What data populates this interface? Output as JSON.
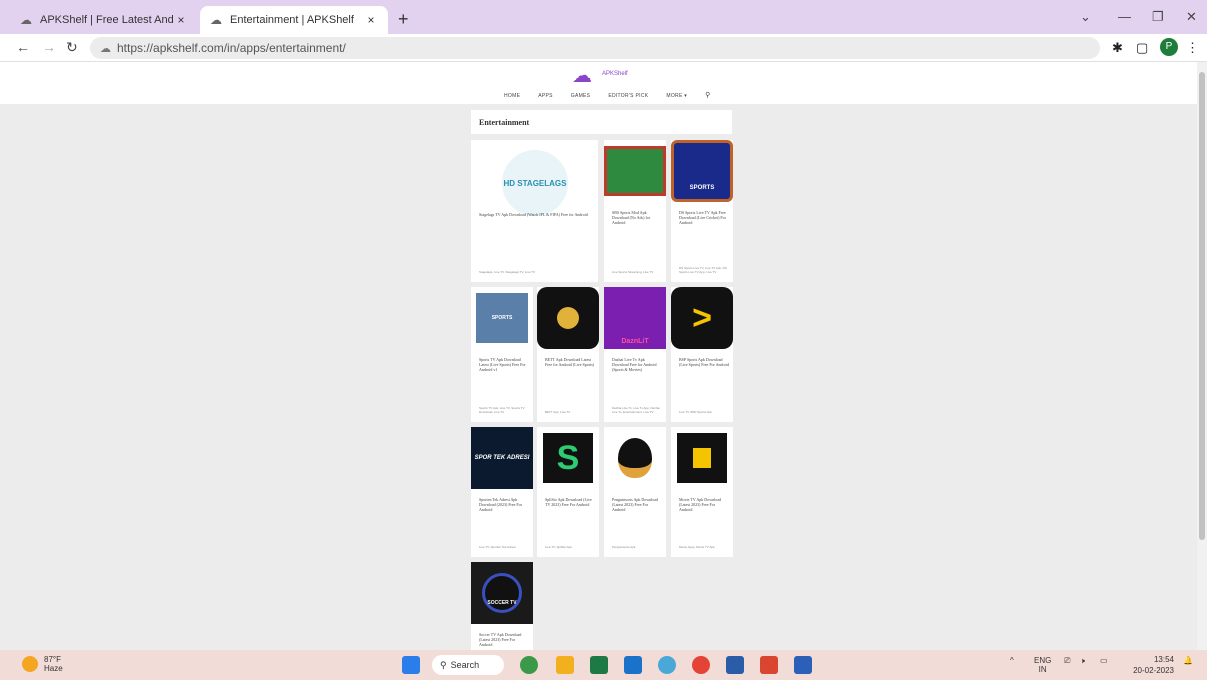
{
  "browser": {
    "tabs": [
      {
        "title": "APKShelf | Free Latest Android A",
        "close": "×"
      },
      {
        "title": "Entertainment | APKShelf",
        "close": "×"
      }
    ],
    "new_tab": "+",
    "url": "https://apkshelf.com/in/apps/entertainment/",
    "profile_initial": "P"
  },
  "site": {
    "logo_text": "APKShelf",
    "menu": [
      "HOME",
      "APPS",
      "GAMES",
      "EDITOR'S PICK",
      "MORE ▾"
    ],
    "section_title": "Entertainment"
  },
  "cards": [
    {
      "title": "Stagelags TV Apk Download (Watch IPL & FIFA) Free for Android",
      "meta": "Stagelags, Live TV, Stagelags TV, Live TV",
      "thumb_label": "HD STAGELAGS",
      "thumb_color": "#e8f4f8"
    },
    {
      "title": "SBS Sports Mod Apk Download (No Ads) for Android",
      "meta": "Live Sports Streaming, Live TV",
      "thumb_label": "",
      "thumb_color": "#2d8a3e"
    },
    {
      "title": "DS Sports Live TV Apk Free Download (Live Cricket) For Android",
      "meta": "DS Sports Live TV, Live TV Apk, DS Sports Live TV App, Live TV",
      "thumb_label": "SPORTS",
      "thumb_color": "#1a2a8a"
    },
    {
      "title": "Sports TV Apk Download Latest (Live Sports) Free For Android v1",
      "meta": "Sports TV Apk, Live TV, Sports TV Download, Live TV",
      "thumb_label": "SPORTS",
      "thumb_color": "#5a7fa8"
    },
    {
      "title": "BETT Apk Download Latest Free for Android (Live Sports)",
      "meta": "BETT Apk, Live TV",
      "thumb_label": "",
      "thumb_color": "#111111"
    },
    {
      "title": "Dazhai Live Tv Apk Download Free for Android (Sports & Movies)",
      "meta": "Dazhai Live Tv, Live Tv App, Dazhai Live Tv, Entertainment, Live TV",
      "thumb_label": "DaznLiT",
      "thumb_color": "#7a1fb0"
    },
    {
      "title": "BSP Sports Apk Download (Live Sports) Free For Android",
      "meta": "Live TV, BSP Sports Apk",
      "thumb_label": "",
      "thumb_color": "#111111"
    },
    {
      "title": "Sporten Tek Adresi Apk Download (2023) Free For Android",
      "meta": "Live TV, Sporten Tek Adresi",
      "thumb_label": "SPOR TEK ADRESI",
      "thumb_color": "#0b1a2e"
    },
    {
      "title": "SpliSto Apk Download (Live TV 2023) Free For Android",
      "meta": "Live TV, SpliSto Apk",
      "thumb_label": "",
      "thumb_color": "#111111"
    },
    {
      "title": "Penguinsorts Apk Download (Latest 2023) Free For Android",
      "meta": "Penguinsorts Apk",
      "thumb_label": "",
      "thumb_color": "#ffffff"
    },
    {
      "title": "Movie TV Apk Download (Latest 2023) Free For Android",
      "meta": "Movie Apps, Movie TV Apk",
      "thumb_label": "",
      "thumb_color": "#111111"
    },
    {
      "title": "Soccer TV Apk Download (Latest 2023) Free For Android",
      "meta": "",
      "thumb_label": "SOCCER TV",
      "thumb_color": "#1a1a1a"
    }
  ],
  "taskbar": {
    "temperature": "87°F",
    "condition": "Haze",
    "search": "Search",
    "lang": "ENG",
    "region": "IN",
    "time": "13:54",
    "date": "20-02-2023"
  }
}
